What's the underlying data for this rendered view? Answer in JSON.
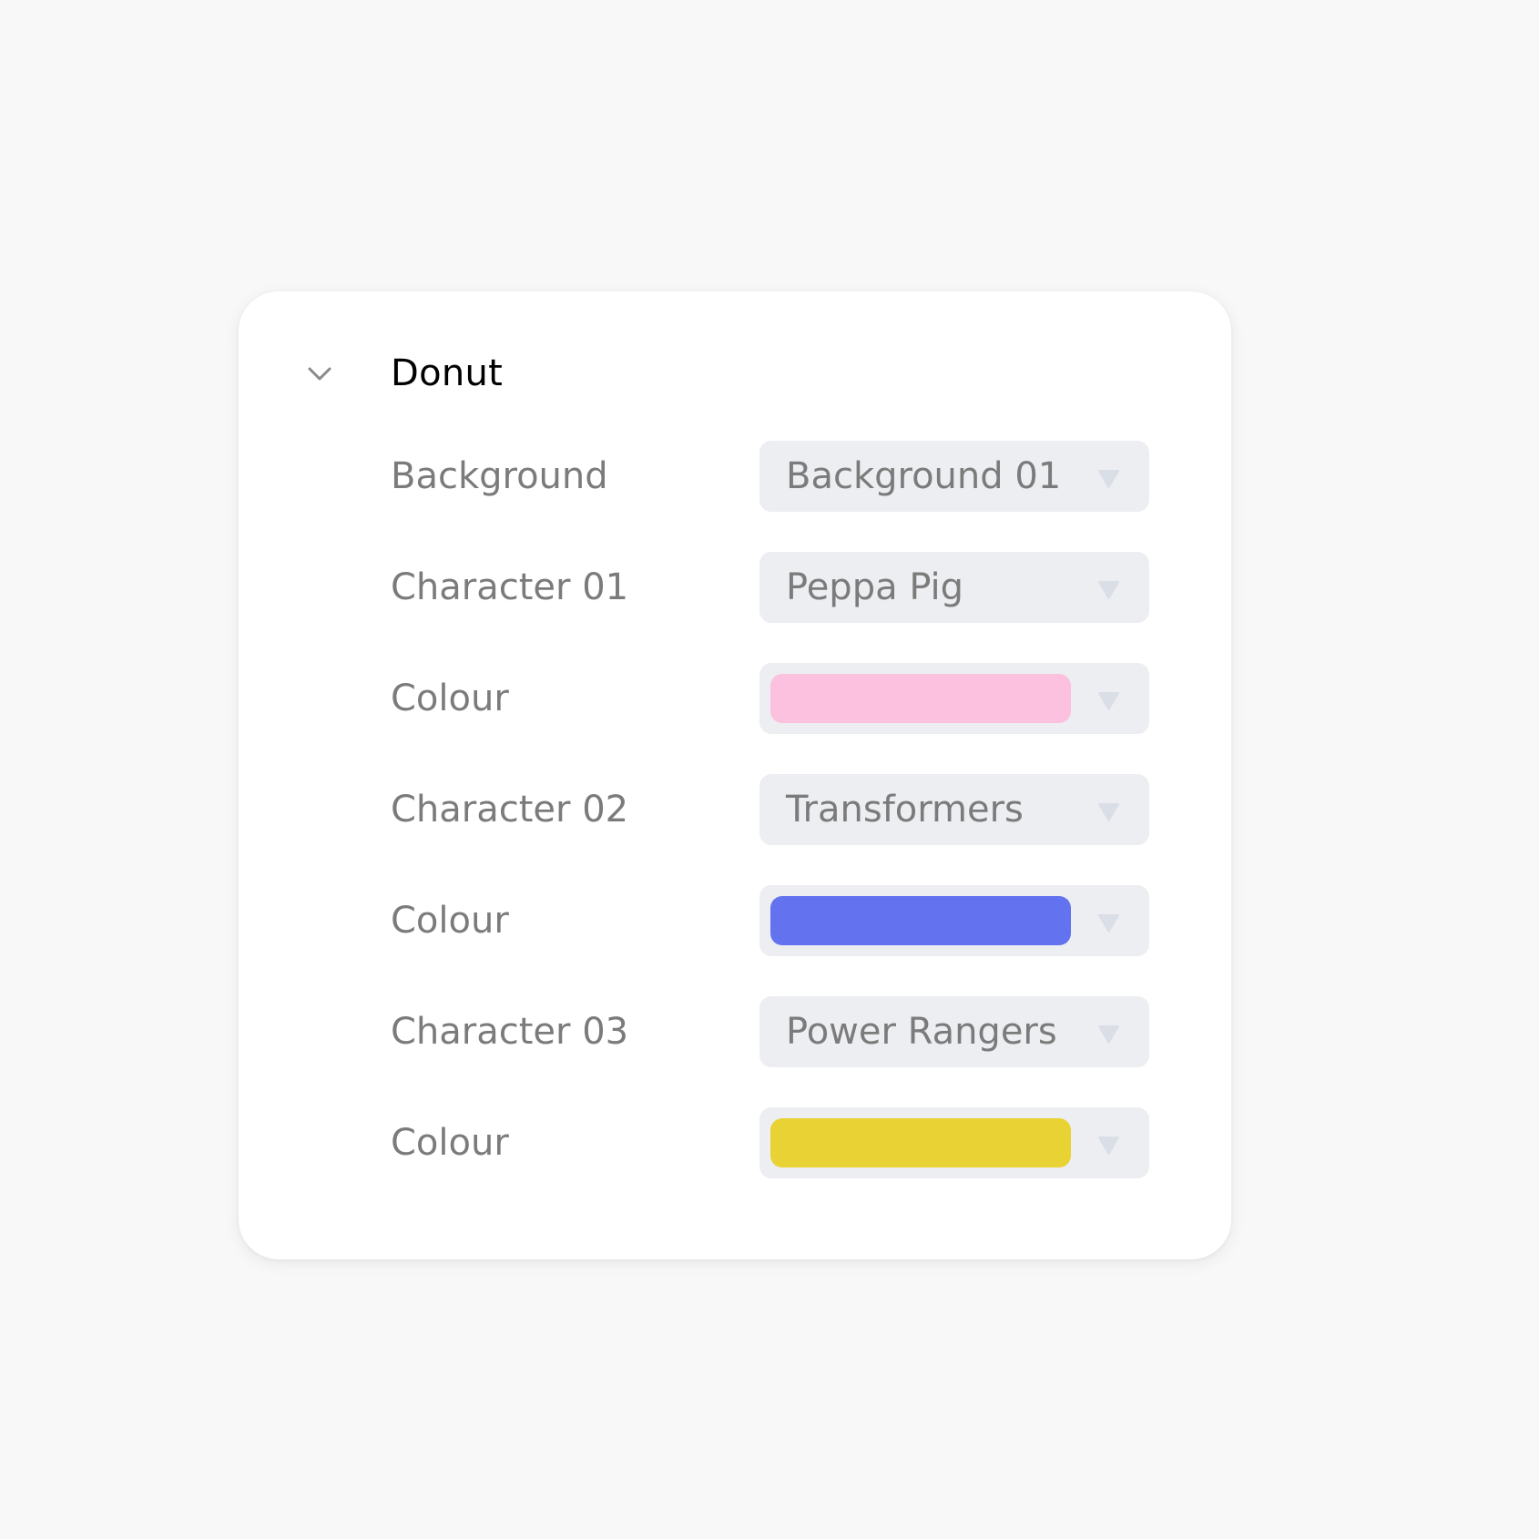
{
  "panel": {
    "title": "Donut",
    "collapse_icon": "chevron-down-icon",
    "rows": [
      {
        "label": "Background",
        "type": "select",
        "value": "Background 01"
      },
      {
        "label": "Character 01",
        "type": "select",
        "value": "Peppa Pig"
      },
      {
        "label": "Colour",
        "type": "color",
        "value": "#fbc1de"
      },
      {
        "label": "Character 02",
        "type": "select",
        "value": "Transformers"
      },
      {
        "label": "Colour",
        "type": "color",
        "value": "#6372ee"
      },
      {
        "label": "Character 03",
        "type": "select",
        "value": "Power Rangers"
      },
      {
        "label": "Colour",
        "type": "color",
        "value": "#e9d234"
      }
    ]
  },
  "colors": {
    "page_bg": "#f8f8f8",
    "card_bg": "#ffffff",
    "dropdown_bg": "#edeef2",
    "dropdown_arrow": "#dadee6",
    "label_text": "#7b7b7b",
    "title_text": "#000000"
  }
}
